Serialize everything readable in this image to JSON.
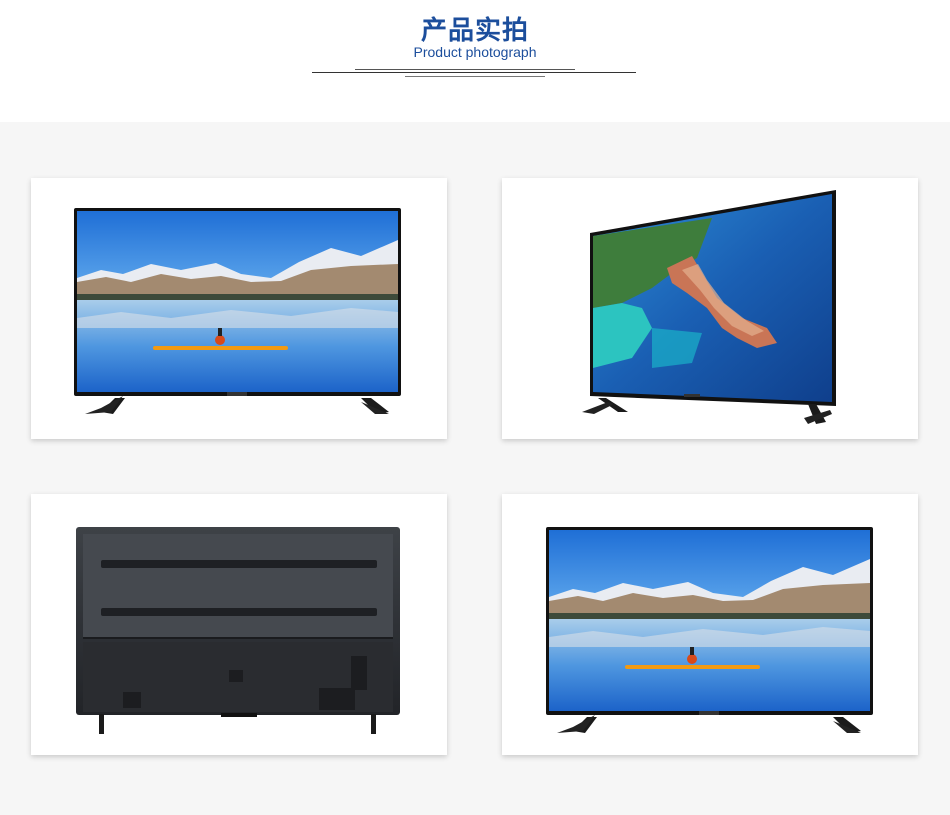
{
  "header": {
    "title_cn": "产品实拍",
    "title_en": "Product photograph"
  },
  "colors": {
    "title": "#1c4e9c",
    "background": "#f6f6f6",
    "card": "#ffffff"
  },
  "photos": [
    {
      "view": "front",
      "screen": "mountain-lake-kayak"
    },
    {
      "view": "angled",
      "screen": "coastline-aerial"
    },
    {
      "view": "back",
      "screen": "none"
    },
    {
      "view": "front",
      "screen": "mountain-lake-kayak"
    }
  ]
}
